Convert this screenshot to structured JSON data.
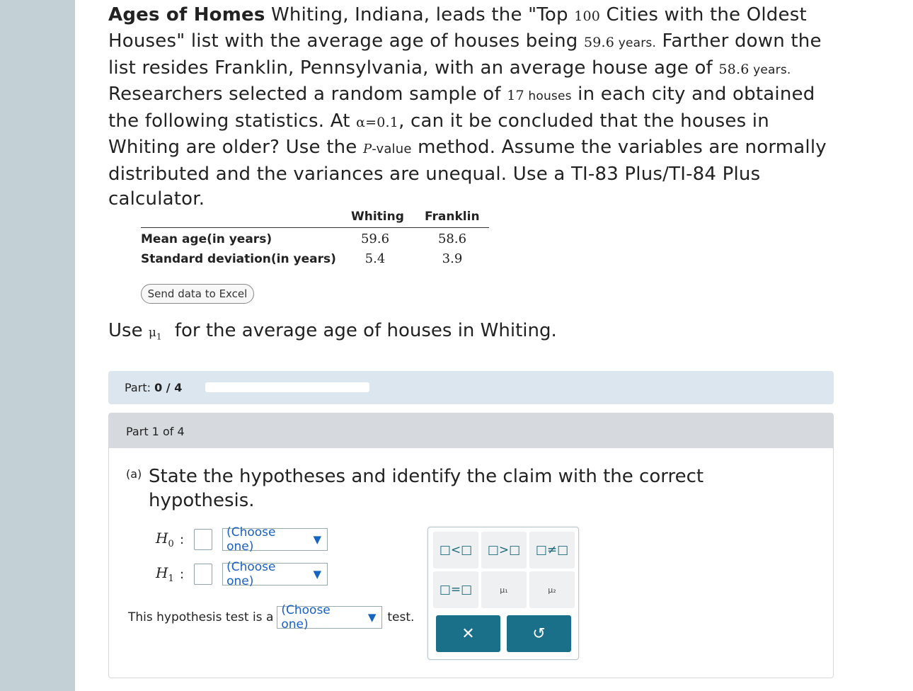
{
  "problem": {
    "title": "Ages of Homes",
    "seg1": " Whiting, Indiana, leads the \"Top ",
    "top_n": "100",
    "seg2": " Cities with the Oldest Houses\" list with the average age of houses being ",
    "whiting_age": "59.6",
    "unit_years": " years.",
    "seg3": " Farther down the list resides Franklin, Pennsylvania, with an average house age of ",
    "franklin_age": "58.6",
    "seg4": " Researchers selected a random sample of ",
    "sample_n": "17",
    "unit_houses": " houses",
    "seg5": " in each city and obtained the following statistics. At ",
    "alpha": "α=0.1",
    "seg6": ", can it be concluded that the houses in Whiting are older? Use the ",
    "p_italic": "P",
    "p_rest": "-value",
    "seg7": " method. Assume the variables are normally distributed and the variances are unequal. Use a TI-83 Plus/TI-84 Plus calculator."
  },
  "stats_table": {
    "columns": [
      "Whiting",
      "Franklin"
    ],
    "rows": [
      {
        "label": "Mean age(in years)",
        "values": [
          "59.6",
          "58.6"
        ]
      },
      {
        "label": "Standard deviation(in years)",
        "values": [
          "5.4",
          "3.9"
        ]
      }
    ]
  },
  "excel_button": "Send data to Excel",
  "use_line": {
    "pre": "Use ",
    "mu": "μ",
    "mu_sub": "1",
    "post": "for the average age of houses in Whiting."
  },
  "progress": {
    "label": "Part:",
    "value": "0 / 4",
    "fraction": 0
  },
  "part_header": "Part 1 of 4",
  "question": {
    "tag": "(a)",
    "text": "State the hypotheses and identify the claim with the correct hypothesis."
  },
  "hypotheses": [
    {
      "symbol": "H",
      "sub": "0",
      "select": "(Choose one)"
    },
    {
      "symbol": "H",
      "sub": "1",
      "select": "(Choose one)"
    }
  ],
  "test_line": {
    "pre": "This hypothesis test is a",
    "select": "(Choose one)",
    "post": "test."
  },
  "caret": "▼",
  "palette": {
    "buttons": [
      "□<□",
      "□>□",
      "□≠□",
      "□=□",
      "μ₁",
      "μ₂"
    ],
    "clear": "✕",
    "undo": "↺"
  },
  "colors": {
    "accent": "#1a7088",
    "link_blue": "#1a5fc4",
    "rail": "#c3d0d6",
    "part_bar": "#dbe6ee"
  }
}
